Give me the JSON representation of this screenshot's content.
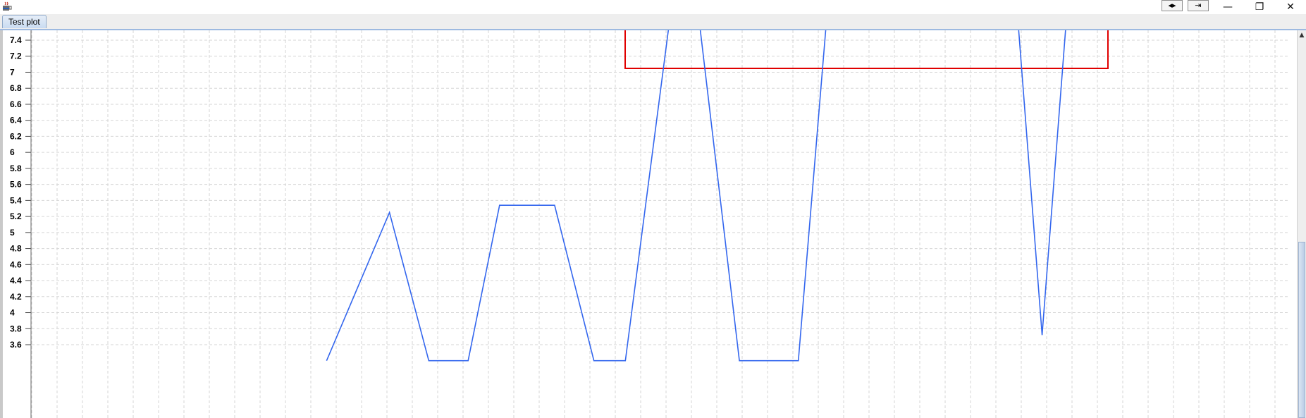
{
  "window": {
    "icons": {
      "app": "java-cup-icon",
      "layout_toggle": "left-right-arrows-icon",
      "dock": "dock-window-icon"
    },
    "controls": {
      "minimize_glyph": "—",
      "restore_glyph": "❐",
      "close_glyph": "✕"
    }
  },
  "tabs": [
    {
      "label": "Test plot"
    }
  ],
  "chart_data": {
    "type": "line",
    "title": "",
    "xlabel": "",
    "ylabel": "",
    "ylim": [
      3.5,
      7.5
    ],
    "y_ticks": [
      "3.6",
      "3.8",
      "4",
      "4.2",
      "4.4",
      "4.6",
      "4.8",
      "5",
      "5.2",
      "5.4",
      "5.6",
      "5.8",
      "6",
      "6.2",
      "6.4",
      "6.6",
      "6.8",
      "7",
      "7.2",
      "7.4"
    ],
    "grid": true,
    "line_color": "#3366ee",
    "highlight_color": "#e00000",
    "series": [
      {
        "values": [
          [
            37.5,
            3.4
          ],
          [
            45.5,
            5.25
          ],
          [
            50.5,
            3.4
          ],
          [
            55.5,
            3.4
          ],
          [
            59.5,
            5.34
          ],
          [
            66.5,
            5.34
          ],
          [
            71.5,
            3.4
          ],
          [
            75.5,
            3.4
          ],
          [
            81,
            7.55
          ],
          [
            85,
            7.55
          ],
          [
            90,
            3.4
          ],
          [
            97.5,
            3.4
          ],
          [
            101,
            7.55
          ],
          [
            125.5,
            7.55
          ],
          [
            128.5,
            3.72
          ],
          [
            131.5,
            7.55
          ]
        ]
      }
    ],
    "x_domain": [
      0,
      160
    ]
  }
}
